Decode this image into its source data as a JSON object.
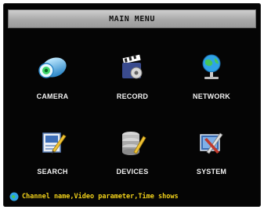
{
  "title": "MAIN MENU",
  "menu": {
    "items": [
      {
        "label": "CAMERA",
        "icon": "camera-icon"
      },
      {
        "label": "RECORD",
        "icon": "record-icon"
      },
      {
        "label": "NETWORK",
        "icon": "network-icon"
      },
      {
        "label": "SEARCH",
        "icon": "search-icon"
      },
      {
        "label": "DEVICES",
        "icon": "devices-icon"
      },
      {
        "label": "SYSTEM",
        "icon": "system-icon"
      }
    ]
  },
  "status": {
    "text": "Channel name,Video parameter,Time shows",
    "icon": "info-icon"
  },
  "colors": {
    "background": "#050505",
    "label": "#f2f2f2",
    "status_text": "#f2d21a",
    "title_bar": "#b5b5b5"
  }
}
